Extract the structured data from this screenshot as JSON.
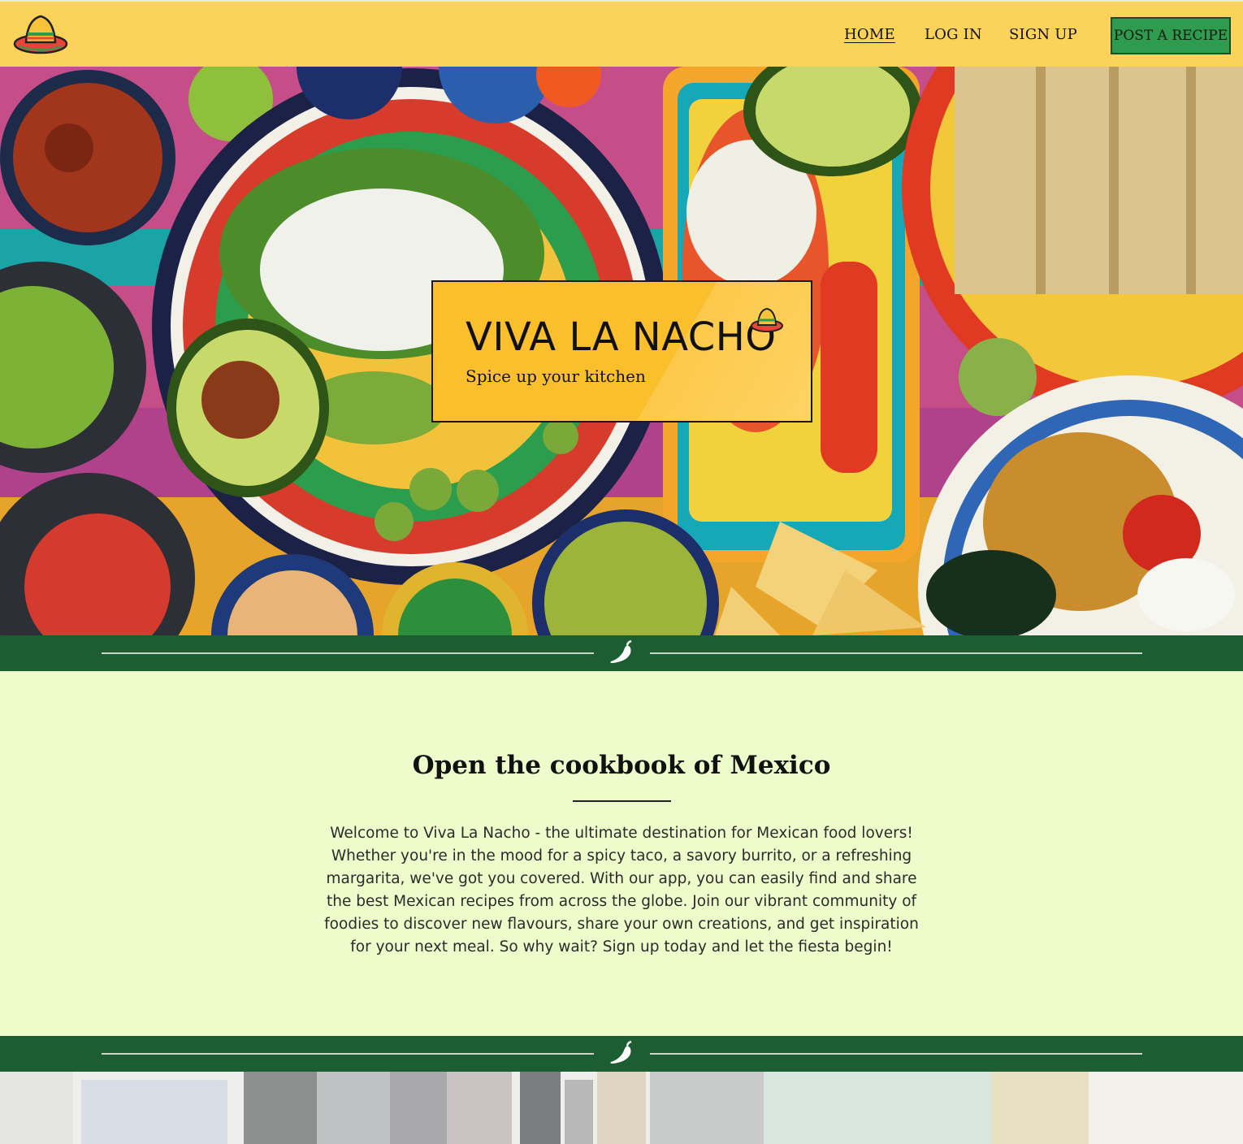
{
  "navbar": {
    "logo_icon": "sombrero-icon",
    "links": [
      {
        "label": "HOME",
        "active": true
      },
      {
        "label": "LOG IN",
        "active": false
      },
      {
        "label": "SIGN UP",
        "active": false
      }
    ],
    "cta_label": "POST A RECIPE"
  },
  "hero": {
    "title": "VIVA LA NACHO",
    "subtitle": "Spice up your kitchen",
    "title_icon": "sombrero-icon"
  },
  "divider": {
    "icon": "chili-pepper-icon"
  },
  "intro": {
    "heading": "Open the cookbook of Mexico",
    "paragraph": "Welcome to Viva La Nacho - the ultimate destination for Mexican food lovers! Whether you're in the mood for a spicy taco, a savory burrito, or a refreshing margarita, we've got you covered. With our app, you can easily find and share the best Mexican recipes from across the globe. Join our vibrant community of foodies to discover new flavours, share your own creations, and get inspiration for your next meal. So why wait? Sign up today and let the fiesta begin!"
  },
  "colors": {
    "navbar_bg": "#fbd35a",
    "cta_bg": "#2e9b4e",
    "divider_bg": "#1c5e31",
    "intro_bg": "#eefccb",
    "hero_card_bg": "#fbbf2c"
  }
}
